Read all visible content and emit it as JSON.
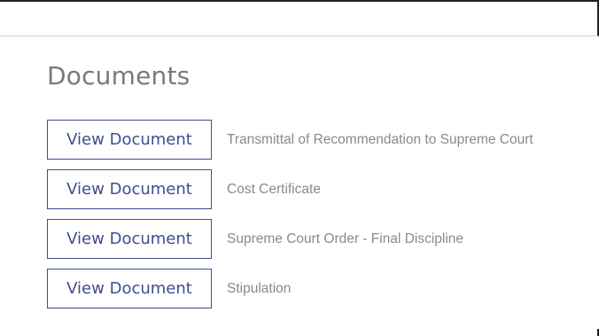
{
  "documents_section": {
    "title": "Documents",
    "items": [
      {
        "button_label": "View Document",
        "name": "Transmittal of Recommendation to Supreme Court"
      },
      {
        "button_label": "View Document",
        "name": "Cost Certificate"
      },
      {
        "button_label": "View Document",
        "name": "Supreme Court Order - Final Discipline"
      },
      {
        "button_label": "View Document",
        "name": "Stipulation"
      }
    ]
  },
  "colors": {
    "button_border": "#3f4d8f",
    "button_text": "#3f4d8f",
    "title_text": "#7a7a7a",
    "doc_text": "#8a8a8a"
  }
}
